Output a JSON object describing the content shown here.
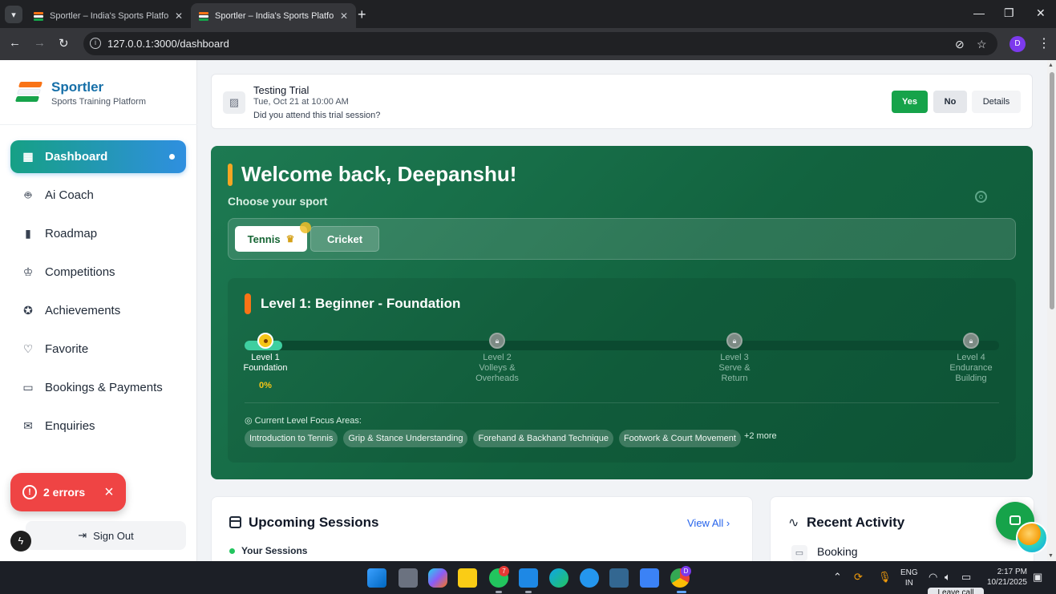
{
  "browser": {
    "tabs": [
      {
        "title": "Sportler – India's Sports Platform"
      },
      {
        "title": "Sportler – India's Sports Platform"
      }
    ],
    "url": "127.0.0.1:3000/dashboard",
    "profile_initial": "D"
  },
  "sidebar": {
    "brand": "Sportler",
    "tagline": "Sports Training Platform",
    "items": [
      {
        "label": "Dashboard",
        "icon": "dashboard-icon",
        "active": true
      },
      {
        "label": "Ai Coach",
        "icon": "robot-icon"
      },
      {
        "label": "Roadmap",
        "icon": "bar-chart-icon"
      },
      {
        "label": "Competitions",
        "icon": "trophy-icon"
      },
      {
        "label": "Achievements",
        "icon": "award-icon"
      },
      {
        "label": "Favorite",
        "icon": "heart-icon"
      },
      {
        "label": "Bookings & Payments",
        "icon": "calendar-icon"
      },
      {
        "label": "Enquiries",
        "icon": "mail-icon"
      }
    ],
    "sign_out": "Sign Out",
    "errors_label": "2 errors"
  },
  "trial": {
    "title": "Testing Trial",
    "datetime": "Tue, Oct 21 at 10:00 AM",
    "question": "Did you attend this trial session?",
    "yes": "Yes",
    "no": "No",
    "details": "Details"
  },
  "hero": {
    "welcome": "Welcome back, Deepanshu!",
    "choose_sport": "Choose your sport",
    "sports": [
      {
        "label": "Tennis",
        "selected": true
      },
      {
        "label": "Cricket"
      }
    ],
    "level_title": "Level 1: Beginner - Foundation",
    "levels": [
      {
        "name": "Level 1",
        "desc": "Foundation",
        "progress": "0%",
        "current": true
      },
      {
        "name": "Level 2",
        "desc": "Volleys &",
        "desc2": "Overheads"
      },
      {
        "name": "Level 3",
        "desc": "Serve &",
        "desc2": "Return"
      },
      {
        "name": "Level 4",
        "desc": "Endurance",
        "desc2": "Building"
      }
    ],
    "focus_heading": "◎ Current Level Focus Areas:",
    "focus_areas": [
      "Introduction to Tennis",
      "Grip & Stance Understanding",
      "Forehand & Backhand Technique",
      "Footwork & Court Movement"
    ],
    "more": "+2 more"
  },
  "sessions": {
    "title": "Upcoming Sessions",
    "view_all": "View All",
    "your_sessions": "Your Sessions"
  },
  "activity": {
    "title": "Recent Activity",
    "first_item": "Booking"
  },
  "taskbar": {
    "whatsapp_badge": "7",
    "chrome_badge": "D",
    "lang_line1": "ENG",
    "lang_line2": "IN",
    "time": "2:17 PM",
    "date": "10/21/2025",
    "toast": "Leave call"
  },
  "colors": {
    "primary_green": "#16a34a",
    "hero_green": "#12633f",
    "accent_orange": "#f97316",
    "brand_blue": "#166fa8",
    "error_red": "#ef4444"
  }
}
